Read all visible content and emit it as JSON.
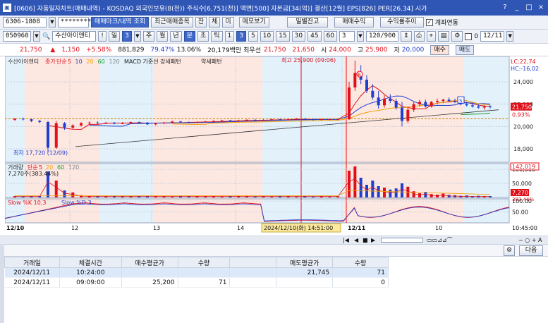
{
  "window": {
    "title": "[0606] 자동일자차트(매매내역) - KOSDAQ 외국인보유(8(천)) 주식수[6,751(천)] 액면[500] 자본금[34(억)] 결산[12월] EPS[826] PER[26.34] 시가",
    "icon": "app-icon",
    "buttons": [
      "?",
      "_",
      "□",
      "×"
    ]
  },
  "toolbar1": {
    "account": "6306-1808",
    "password_mask": "********",
    "tab_marks": "매매마크/내역 조회",
    "recent_items": "최근매매종목",
    "jan": "잔",
    "che": "체",
    "mi": "미",
    "memo": "메모보기",
    "daily_balance": "일별잔고",
    "trade_profit": "매매수익",
    "profit_trend": "수익률추이",
    "account_link_label": "계좌연동"
  },
  "toolbar2": {
    "code": "050960",
    "name": "수산아이앤티",
    "excl": "!",
    "day_unit": "일",
    "period_num": "3",
    "periods": [
      "주",
      "월",
      "년",
      "분",
      "초",
      "틱"
    ],
    "active_period": "분",
    "minutes": [
      "1",
      "3",
      "5",
      "10",
      "15",
      "30",
      "45",
      "60"
    ],
    "active_minute": "3",
    "count_sel": "3",
    "bars": "120/900",
    "date_start": "0",
    "date": "12/11"
  },
  "quote": {
    "price": "21,750",
    "change": "1,150",
    "pct": "+5.58%",
    "volume": "881,829",
    "ratio1": "79.47%",
    "ratio2": "13.06%",
    "amount": "20,179백만",
    "best_ask_label": "최우선",
    "ask": "21,750",
    "bid": "21,650",
    "open_label": "시",
    "open": "24,000",
    "high_label": "고",
    "high": "25,900",
    "low_label": "저",
    "low": "20,000",
    "buy": "매수",
    "sell": "매도"
  },
  "chart_data": {
    "type": "candlestick",
    "price_panel": {
      "legend": [
        "수산아이앤티",
        "종가",
        "단순",
        "5",
        "10",
        "20",
        "60",
        "120",
        "MACD 기준선 강세패턴",
        "약세패턴"
      ],
      "ylim": [
        16800,
        25400
      ],
      "yticks": [
        "24,000",
        "22,000",
        "20,000",
        "18,000"
      ],
      "right_top": "LC:22,74",
      "right_top2": "HC:-16,02",
      "last_price": "21,750",
      "last_pct": "0.93%",
      "high_annotation": "최고 25,900 (09:06)",
      "low_annotation": "최저 17,720 (12/09)",
      "markers": [
        "B",
        "S"
      ],
      "candles": [
        [
          20600,
          20750,
          20500,
          20700
        ],
        [
          20700,
          20800,
          20550,
          20650
        ],
        [
          20650,
          20700,
          20400,
          20500
        ],
        [
          20500,
          20600,
          20300,
          20400
        ],
        [
          20400,
          20500,
          17720,
          18100
        ],
        [
          18100,
          20500,
          18000,
          20300
        ],
        [
          20300,
          20400,
          19700,
          19900
        ],
        [
          19900,
          20200,
          19800,
          20100
        ],
        [
          20100,
          20400,
          20000,
          20300
        ],
        [
          20300,
          20450,
          20200,
          20350
        ],
        [
          20350,
          20450,
          20250,
          20300
        ],
        [
          20300,
          20400,
          20250,
          20350
        ],
        [
          20350,
          20400,
          20200,
          20250
        ],
        [
          20250,
          20400,
          20200,
          20300
        ],
        [
          20300,
          20450,
          20250,
          20400
        ],
        [
          20400,
          20450,
          20300,
          20350
        ],
        [
          20350,
          20400,
          20150,
          20200
        ],
        [
          20200,
          20350,
          20100,
          20300
        ],
        [
          20300,
          20400,
          20200,
          20350
        ],
        [
          20350,
          20500,
          20300,
          20450
        ],
        [
          20450,
          20500,
          20350,
          20400
        ],
        [
          20400,
          20450,
          20300,
          20350
        ],
        [
          20350,
          20450,
          20300,
          20400
        ],
        [
          20400,
          20500,
          20350,
          20450
        ],
        [
          20450,
          20550,
          20400,
          20500
        ],
        [
          20500,
          20600,
          20450,
          20550
        ],
        [
          20550,
          20600,
          20450,
          20500
        ],
        [
          20500,
          20600,
          20450,
          20550
        ],
        [
          20550,
          20650,
          20500,
          20600
        ],
        [
          20600,
          20650,
          20500,
          20550
        ],
        [
          20550,
          20650,
          20500,
          20600
        ],
        [
          20600,
          20700,
          20550,
          20650
        ],
        [
          20650,
          20700,
          20550,
          20600
        ],
        [
          20600,
          20700,
          20550,
          20650
        ],
        [
          20650,
          20750,
          20600,
          20700
        ],
        [
          20700,
          20750,
          20600,
          20650
        ],
        [
          20650,
          20700,
          20550,
          20600
        ],
        [
          20600,
          20700,
          20550,
          20650
        ],
        [
          20650,
          20700,
          20600,
          20650
        ],
        [
          20650,
          20700,
          20600,
          20650
        ],
        [
          20650,
          24000,
          20600,
          23500
        ],
        [
          23500,
          25900,
          23200,
          24800
        ],
        [
          24800,
          25500,
          23800,
          24200
        ],
        [
          24200,
          24600,
          23000,
          23200
        ],
        [
          23200,
          23800,
          22400,
          22600
        ],
        [
          22600,
          23200,
          21600,
          21900
        ],
        [
          21900,
          22800,
          21700,
          22500
        ],
        [
          22500,
          22900,
          22100,
          22300
        ],
        [
          22300,
          22500,
          21500,
          21700
        ],
        [
          21700,
          22200,
          20000,
          20500
        ],
        [
          20500,
          21800,
          20300,
          21500
        ],
        [
          21500,
          22200,
          21300,
          22000
        ],
        [
          22000,
          22400,
          21800,
          22200
        ],
        [
          22200,
          22400,
          21700,
          21800
        ],
        [
          21800,
          22300,
          21700,
          22200
        ],
        [
          22200,
          22500,
          22000,
          22300
        ],
        [
          22300,
          22500,
          22100,
          22400
        ],
        [
          22400,
          22600,
          22200,
          22300
        ],
        [
          22300,
          22500,
          22100,
          22200
        ],
        [
          22200,
          22400,
          21900,
          22000
        ],
        [
          22000,
          22200,
          21800,
          21900
        ],
        [
          21900,
          22100,
          21700,
          21800
        ],
        [
          21800,
          22000,
          21600,
          21700
        ],
        [
          21700,
          21900,
          21500,
          21800
        ],
        [
          21800,
          21900,
          21600,
          21750
        ]
      ]
    },
    "volume_panel": {
      "legend": [
        "거래량",
        "단순",
        "5",
        "20",
        "60",
        "120"
      ],
      "value_label": "7,270주(383.44%)",
      "yticks": [
        "100,000",
        "50,000"
      ],
      "right_label": "142,019",
      "last_value": "7,270",
      "last_pct": "383.44%",
      "values": [
        5,
        3,
        4,
        6,
        92,
        60,
        25,
        18,
        8,
        6,
        5,
        4,
        6,
        5,
        4,
        5,
        6,
        4,
        5,
        3,
        4,
        5,
        6,
        4,
        5,
        3,
        4,
        4,
        5,
        3,
        4,
        3,
        5,
        4,
        3,
        4,
        3,
        4,
        3,
        4,
        95,
        110,
        70,
        45,
        60,
        40,
        35,
        28,
        32,
        50,
        38,
        22,
        15,
        20,
        12,
        10,
        14,
        9,
        8,
        6,
        7,
        5,
        6,
        4,
        5
      ]
    },
    "stoch_panel": {
      "legend": [
        "Slow %K 10,3",
        "Slow %D 3"
      ],
      "yticks": [
        "100.00",
        "50.00"
      ]
    },
    "x_labels": [
      "12/10",
      "12",
      "13",
      "14",
      "12/11",
      "10"
    ],
    "time_label": "10:45:00",
    "cursor_label": "2024/12/10(화) 14:51:00"
  },
  "table": {
    "headers": [
      "거래일",
      "체결시간",
      "매수평균가",
      "수량",
      "",
      "매도평균가",
      "수량"
    ],
    "rows": [
      {
        "date": "2024/12/11",
        "time": "10:24:00",
        "buy_avg": "",
        "buy_qty": "",
        "blank": "",
        "sell_avg": "21,745",
        "sell_qty": "71"
      },
      {
        "date": "2024/12/11",
        "time": "09:09:00",
        "buy_avg": "25,200",
        "buy_qty": "71",
        "blank": "",
        "sell_avg": "",
        "sell_qty": "0"
      }
    ]
  },
  "panel": {
    "next_button": "다음"
  },
  "colors": {
    "title_bg": "#2f55b5",
    "up": "#e0101a",
    "down": "#1f3fd1",
    "shade_pink": "#fde7e1",
    "shade_blue": "#e3f1fb"
  }
}
